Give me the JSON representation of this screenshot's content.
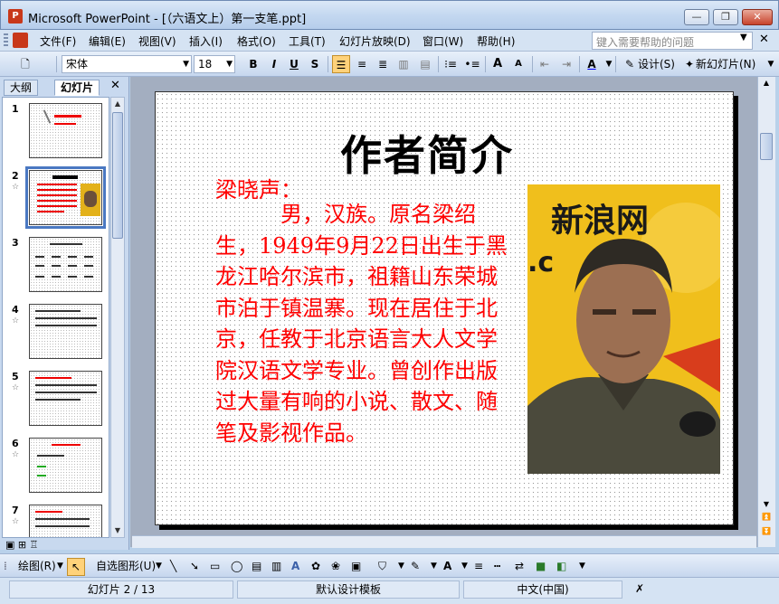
{
  "window": {
    "title": "Microsoft PowerPoint - [（六语文上）第一支笔.ppt]",
    "minimize": "—",
    "restore": "❐",
    "close": "✕",
    "app_icon": "P"
  },
  "menubar": {
    "items": [
      "文件(F)",
      "编辑(E)",
      "视图(V)",
      "插入(I)",
      "格式(O)",
      "工具(T)",
      "幻灯片放映(D)",
      "窗口(W)",
      "帮助(H)"
    ],
    "help_placeholder": "键入需要帮助的问题"
  },
  "toolbar": {
    "font_name": "宋体",
    "font_size": "18",
    "bold": "B",
    "italic": "I",
    "underline": "U",
    "shadow": "S",
    "font_color_label": "A",
    "design_label": "设计(S)",
    "new_slide_label": "新幻灯片(N)",
    "grow_font": "A",
    "shrink_font": "A"
  },
  "leftpane": {
    "tabs": [
      "大纲",
      "幻灯片"
    ],
    "slide_numbers": [
      "1",
      "2",
      "3",
      "4",
      "5",
      "6",
      "7"
    ],
    "selected_index": 1
  },
  "slide": {
    "title": "作者简介",
    "author_label": "梁晓声：",
    "bio": "男，汉族。原名梁绍生，1949年9月22日出生于黑龙江哈尔滨市，祖籍山东荣城市泊于镇温寨。现在居住于北京，任教于北京语言大人文学院汉语文学专业。曾创作出版过大量有响的小说、散文、随笔及影视作品。",
    "photo_caption": "新浪网"
  },
  "drawbar": {
    "draw_label": "绘图(R)",
    "autoshapes_label": "自选图形(U)"
  },
  "statusbar": {
    "slide_indicator": "幻灯片 2 / 13",
    "template": "默认设计模板",
    "language": "中文(中国)"
  },
  "colors": {
    "slide_text_red": "#ff0000",
    "selection_blue": "#4a78c2",
    "toolbar_highlight": "#ffd27a"
  }
}
